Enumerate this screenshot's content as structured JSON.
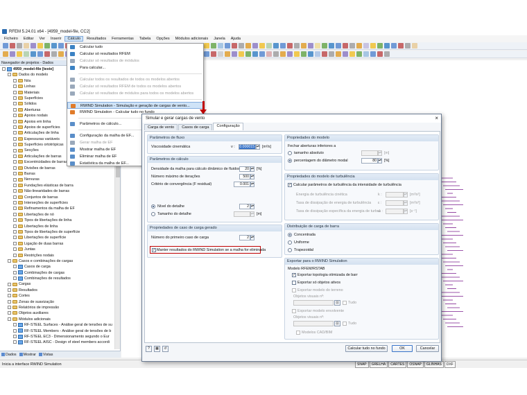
{
  "window": {
    "title": "RFEM 5.24.01 x64 - [4959_model-file, CC2]"
  },
  "menubar": [
    "Ficheiro",
    "Editar",
    "Ver",
    "Inserir",
    "Cálculo",
    "Resultados",
    "Ferramentas",
    "Tabela",
    "Opções",
    "Módulos adicionais",
    "Janela",
    "Ajuda"
  ],
  "navigator": {
    "title": "Navegador de projetos - Dados",
    "tree": [
      {
        "label": "4959_model-file [teste]",
        "indent": 0,
        "bold": true,
        "icon": "doc"
      },
      {
        "label": "Dados do modelo",
        "indent": 1,
        "icon": "folder"
      },
      {
        "label": "Nós",
        "indent": 2,
        "icon": "folder"
      },
      {
        "label": "Linhas",
        "indent": 2,
        "icon": "folder"
      },
      {
        "label": "Materiais",
        "indent": 2,
        "icon": "folder"
      },
      {
        "label": "Superfícies",
        "indent": 2,
        "icon": "folder"
      },
      {
        "label": "Sólidos",
        "indent": 2,
        "icon": "folder"
      },
      {
        "label": "Aberturas",
        "indent": 2,
        "icon": "folder"
      },
      {
        "label": "Apoios nodais",
        "indent": 2,
        "icon": "folder"
      },
      {
        "label": "Apoios em linha",
        "indent": 2,
        "icon": "folder"
      },
      {
        "label": "Apoios de superfícies",
        "indent": 2,
        "icon": "folder"
      },
      {
        "label": "Articulações de linha",
        "indent": 2,
        "icon": "folder"
      },
      {
        "label": "Espessuras variáveis",
        "indent": 2,
        "icon": "folder"
      },
      {
        "label": "Superfícies ortotrópicas",
        "indent": 2,
        "icon": "folder"
      },
      {
        "label": "Secções",
        "indent": 2,
        "icon": "folder"
      },
      {
        "label": "Articulações de barras",
        "indent": 2,
        "icon": "folder"
      },
      {
        "label": "Excentricidades de barras",
        "indent": 2,
        "icon": "folder"
      },
      {
        "label": "Divisões de barras",
        "indent": 2,
        "icon": "folder"
      },
      {
        "label": "Barras",
        "indent": 2,
        "icon": "folder"
      },
      {
        "label": "Nervuras",
        "indent": 2,
        "icon": "folder"
      },
      {
        "label": "Fundações elásticas de barra",
        "indent": 2,
        "icon": "folder"
      },
      {
        "label": "Não-linearidades de barras",
        "indent": 2,
        "icon": "folder"
      },
      {
        "label": "Conjuntos de barras",
        "indent": 2,
        "icon": "folder"
      },
      {
        "label": "Interseções de superfícies",
        "indent": 2,
        "icon": "folder"
      },
      {
        "label": "Refinamentos da malha de EF",
        "indent": 2,
        "icon": "folder"
      },
      {
        "label": "Libertações de nó",
        "indent": 2,
        "icon": "folder"
      },
      {
        "label": "Tipos de libertações de linha",
        "indent": 2,
        "icon": "folder"
      },
      {
        "label": "Libertações de linha",
        "indent": 2,
        "icon": "folder"
      },
      {
        "label": "Tipos de libertações de superfície",
        "indent": 2,
        "icon": "folder"
      },
      {
        "label": "Libertações de superfície",
        "indent": 2,
        "icon": "folder"
      },
      {
        "label": "Ligação de duas barras",
        "indent": 2,
        "icon": "folder"
      },
      {
        "label": "Juntas",
        "indent": 2,
        "icon": "folder"
      },
      {
        "label": "Restrições nodais",
        "indent": 2,
        "icon": "folder"
      },
      {
        "label": "Casos e combinações de cargas",
        "indent": 1,
        "icon": "folder"
      },
      {
        "label": "Casos de carga",
        "indent": 2,
        "icon": "doc"
      },
      {
        "label": "Combinações de cargas",
        "indent": 2,
        "icon": "doc"
      },
      {
        "label": "Combinações de resultados",
        "indent": 2,
        "icon": "doc"
      },
      {
        "label": "Cargas",
        "indent": 1,
        "icon": "folder"
      },
      {
        "label": "Resultados",
        "indent": 1,
        "icon": "folder"
      },
      {
        "label": "Cortes",
        "indent": 1,
        "icon": "folder"
      },
      {
        "label": "Zonas de suavização",
        "indent": 1,
        "icon": "folder"
      },
      {
        "label": "Relatórios de impressão",
        "indent": 1,
        "icon": "folder"
      },
      {
        "label": "Objetos auxiliares",
        "indent": 1,
        "icon": "folder"
      },
      {
        "label": "Módulos adicionais",
        "indent": 1,
        "icon": "folder"
      },
      {
        "label": "RF-STEEL Surfaces - Análise geral de tensões de su",
        "indent": 2,
        "icon": "doc"
      },
      {
        "label": "RF-STEEL Members - Análise geral de tensões de b",
        "indent": 2,
        "icon": "doc"
      },
      {
        "label": "RF-STEEL EC3 - Dimensionamento segundo o Eur",
        "indent": 2,
        "icon": "doc"
      },
      {
        "label": "RF-STEEL AISC - Design of steel members accordi",
        "indent": 2,
        "icon": "doc"
      }
    ],
    "tabs": [
      "Dados",
      "Mostrar",
      "Vistas"
    ]
  },
  "dropdown": [
    {
      "label": "Calcular tudo",
      "disabled": false,
      "color": "#3b82c4"
    },
    {
      "label": "Calcular só resultados RFEM",
      "disabled": false,
      "color": "#3b82c4"
    },
    {
      "label": "Calcular só resultados de módulos",
      "disabled": true,
      "color": "#9aa9bb"
    },
    {
      "label": "Para calcular...",
      "disabled": false,
      "color": "#3b82c4"
    },
    {
      "sep": true
    },
    {
      "label": "Calcular todos os resultados de todos os modelos abertos",
      "disabled": true,
      "color": "#9aa9bb"
    },
    {
      "label": "Calcular só resultados RFEM de todos os modelos abertos",
      "disabled": true,
      "color": "#9aa9bb"
    },
    {
      "label": "Calcular só resultados de módulos para todos os modelos abertos",
      "disabled": true,
      "color": "#9aa9bb"
    },
    {
      "sep": true
    },
    {
      "label": "RWIND Simulation - Simulação e geração de cargas de vento...",
      "disabled": false,
      "highlight": true,
      "color": "#e07b2a"
    },
    {
      "label": "RWIND Simulation - Calcular tudo no fundo",
      "disabled": false,
      "color": "#e07b2a"
    },
    {
      "sep": true
    },
    {
      "label": "Parâmetros de cálculo...",
      "disabled": false,
      "color": "#5a8ec9"
    },
    {
      "sep": true
    },
    {
      "label": "Configuração da malha de EF...",
      "disabled": false,
      "color": "#5a8ec9"
    },
    {
      "label": "Gerar malha de EF",
      "disabled": true,
      "color": "#9aa9bb"
    },
    {
      "label": "Mostrar malha de EF",
      "disabled": false,
      "color": "#5a8ec9"
    },
    {
      "label": "Eliminar malha de EF",
      "disabled": false,
      "color": "#5a8ec9"
    },
    {
      "label": "Estatística da malha de EF...",
      "disabled": false,
      "color": "#5a8ec9"
    }
  ],
  "dialog": {
    "title": "Simular e gerar cargas de vento",
    "tabs": [
      "Carga de vento",
      "Casos de carga",
      "Configuração"
    ],
    "flow": {
      "title": "Parâmetros de fluxo",
      "viscosity_label": "Viscosidade cinemática",
      "viscosity_symbol": "ν :",
      "viscosity_value": "0.000015",
      "viscosity_unit": "[m²/s]"
    },
    "calc": {
      "title": "Parâmetros de cálculo",
      "density_label": "Densidade da malha para cálculo dinâmico de fluidos",
      "density_value": "20",
      "density_unit": "[%]",
      "iterations_label": "Número máximo de iterações",
      "iterations_value": "500",
      "residual_label": "Critério de convergência (F residual)",
      "residual_value": "0.001",
      "detail_level_label": "Nível do detalhe",
      "detail_level_value": "2",
      "detail_size_label": "Tamanho do detalhe",
      "detail_size_unit": "[m]"
    },
    "lc": {
      "title": "Propriedades de caso de carga gerado",
      "first_lc_label": "Número do primeiro caso de carga",
      "first_lc_value": "2",
      "keep_results_label": "Manter resultados do RWIND Simulation se a malha for eliminada"
    },
    "model": {
      "title": "Propriedades do modelo",
      "close_label": "Fechar aberturas inferiores a",
      "abs_label": "tamanho absoluto",
      "abs_unit": "[m]",
      "pct_label": "percentagem do diâmetro modal",
      "pct_value": "80",
      "pct_unit": "[%]"
    },
    "turb": {
      "title": "Propriedades do modelo de turbulência",
      "calc_label": "Calcular parâmetros de turbulência da intensidade de turbulência",
      "k_label": "Energia de turbulência cinética",
      "k_symbol": "k :",
      "k_unit": "[m²/s²]",
      "eps_label": "Taxa de dissipação de energia de turbulência",
      "eps_symbol": "ε :",
      "eps_unit": "[m²/s³]",
      "omega_label": "Taxa de dissipação específica da energia de turbul.",
      "omega_symbol": "ω :",
      "omega_unit": "[s⁻¹]"
    },
    "dist": {
      "title": "Distribuição de carga de barra",
      "options": [
        "Concentrada",
        "Uniforme",
        "Trapezoidal"
      ]
    },
    "export": {
      "title": "Exportar para o RWIND Simulation",
      "model_label": "Modelo RFEM/RSTAB",
      "opt_topology": "Exportar topologia otimizada de barr",
      "opt_active": "Exportar só objetos ativos",
      "terrain_label": "Exportar modelo do terreno",
      "objects_label": "Objetos visuais nº:",
      "all_label": "Tudo",
      "env_label": "Exportar modelo envolvente",
      "objects2_label": "Objetos visuais nº:",
      "all2_label": "Tudo",
      "cad_label": "Modelos CAD/BIM"
    },
    "buttons": {
      "calc_bg": "Calcular tudo no fundo",
      "ok": "OK",
      "cancel": "Cancelar"
    }
  },
  "statusbar": {
    "text": "Inicia a interface RWIND Simulation",
    "items": [
      "SNAP",
      "GRELHA",
      "CARTES",
      "OSNAP",
      "GLINHAS",
      "DXF"
    ]
  },
  "colors": {
    "accent": "#3874c9",
    "highlight": "#c00000",
    "group_title": "#d4e1f0"
  }
}
